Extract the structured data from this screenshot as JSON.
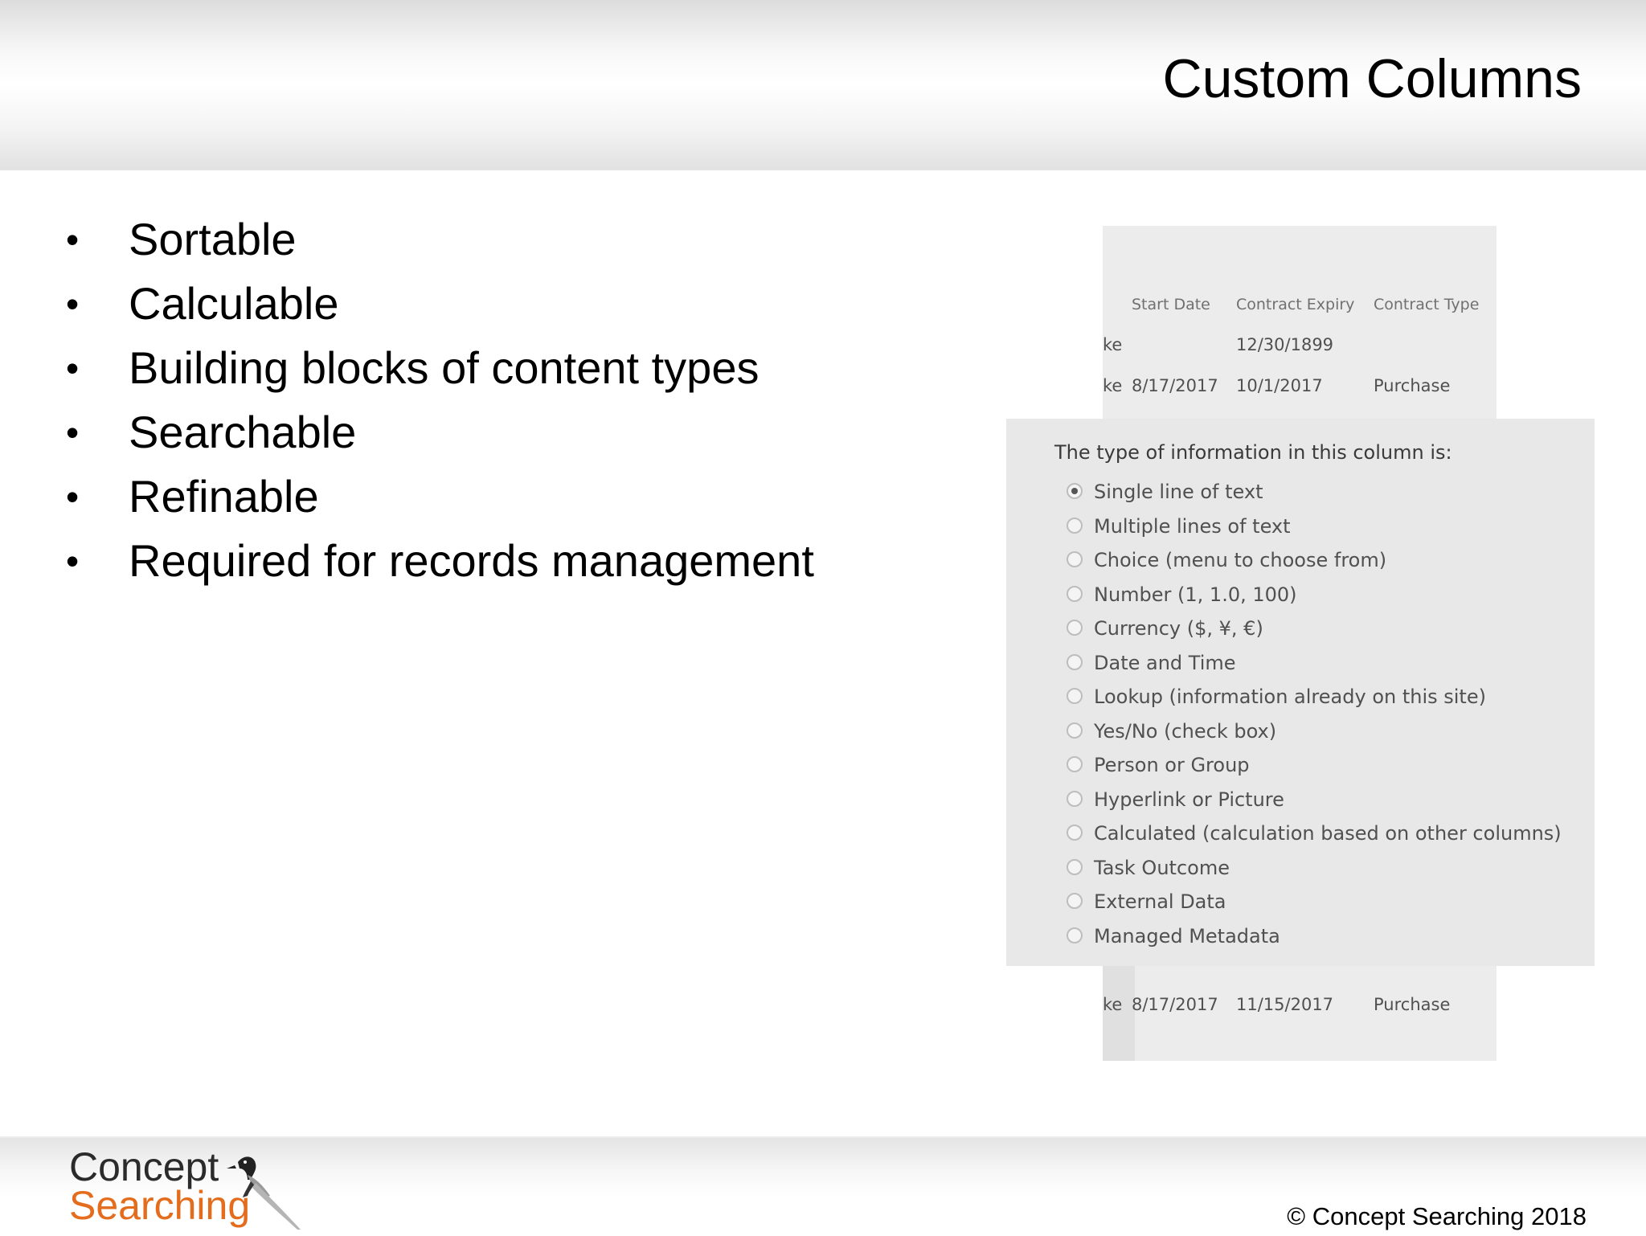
{
  "slide": {
    "title": "Custom Columns",
    "bullets": [
      "Sortable",
      "Calculable",
      "Building blocks of content types",
      "Searchable",
      "Refinable",
      "Required for records management"
    ],
    "bullet_glyph": "•"
  },
  "grid": {
    "headers": [
      "Start Date",
      "Contract Expiry",
      "Contract Type"
    ],
    "rows_top": [
      {
        "prefix": "ke",
        "start": "",
        "expiry": "12/30/1899",
        "type": ""
      },
      {
        "prefix": "ke",
        "start": "8/17/2017",
        "expiry": "10/1/2017",
        "type": "Purchase"
      }
    ],
    "rows_bottom": [
      {
        "prefix": "ke",
        "start": "8/17/2017",
        "expiry": "11/15/2017",
        "type": "Purchase"
      }
    ]
  },
  "column_type_panel": {
    "label": "The type of information in this column is:",
    "selected": "Single line of text",
    "options": [
      "Single line of text",
      "Multiple lines of text",
      "Choice (menu to choose from)",
      "Number (1, 1.0, 100)",
      "Currency ($, ¥, €)",
      "Date and Time",
      "Lookup (information already on this site)",
      "Yes/No (check box)",
      "Person or Group",
      "Hyperlink or Picture",
      "Calculated (calculation based on other columns)",
      "Task Outcome",
      "External Data",
      "Managed Metadata"
    ]
  },
  "footer": {
    "logo_line1": "Concept",
    "logo_line2": "Searching",
    "copyright": "© Concept Searching 2018"
  },
  "colors": {
    "logo_orange": "#e46d1d",
    "logo_dark": "#2b2b2b",
    "panel_bg": "#e8e8e8"
  }
}
